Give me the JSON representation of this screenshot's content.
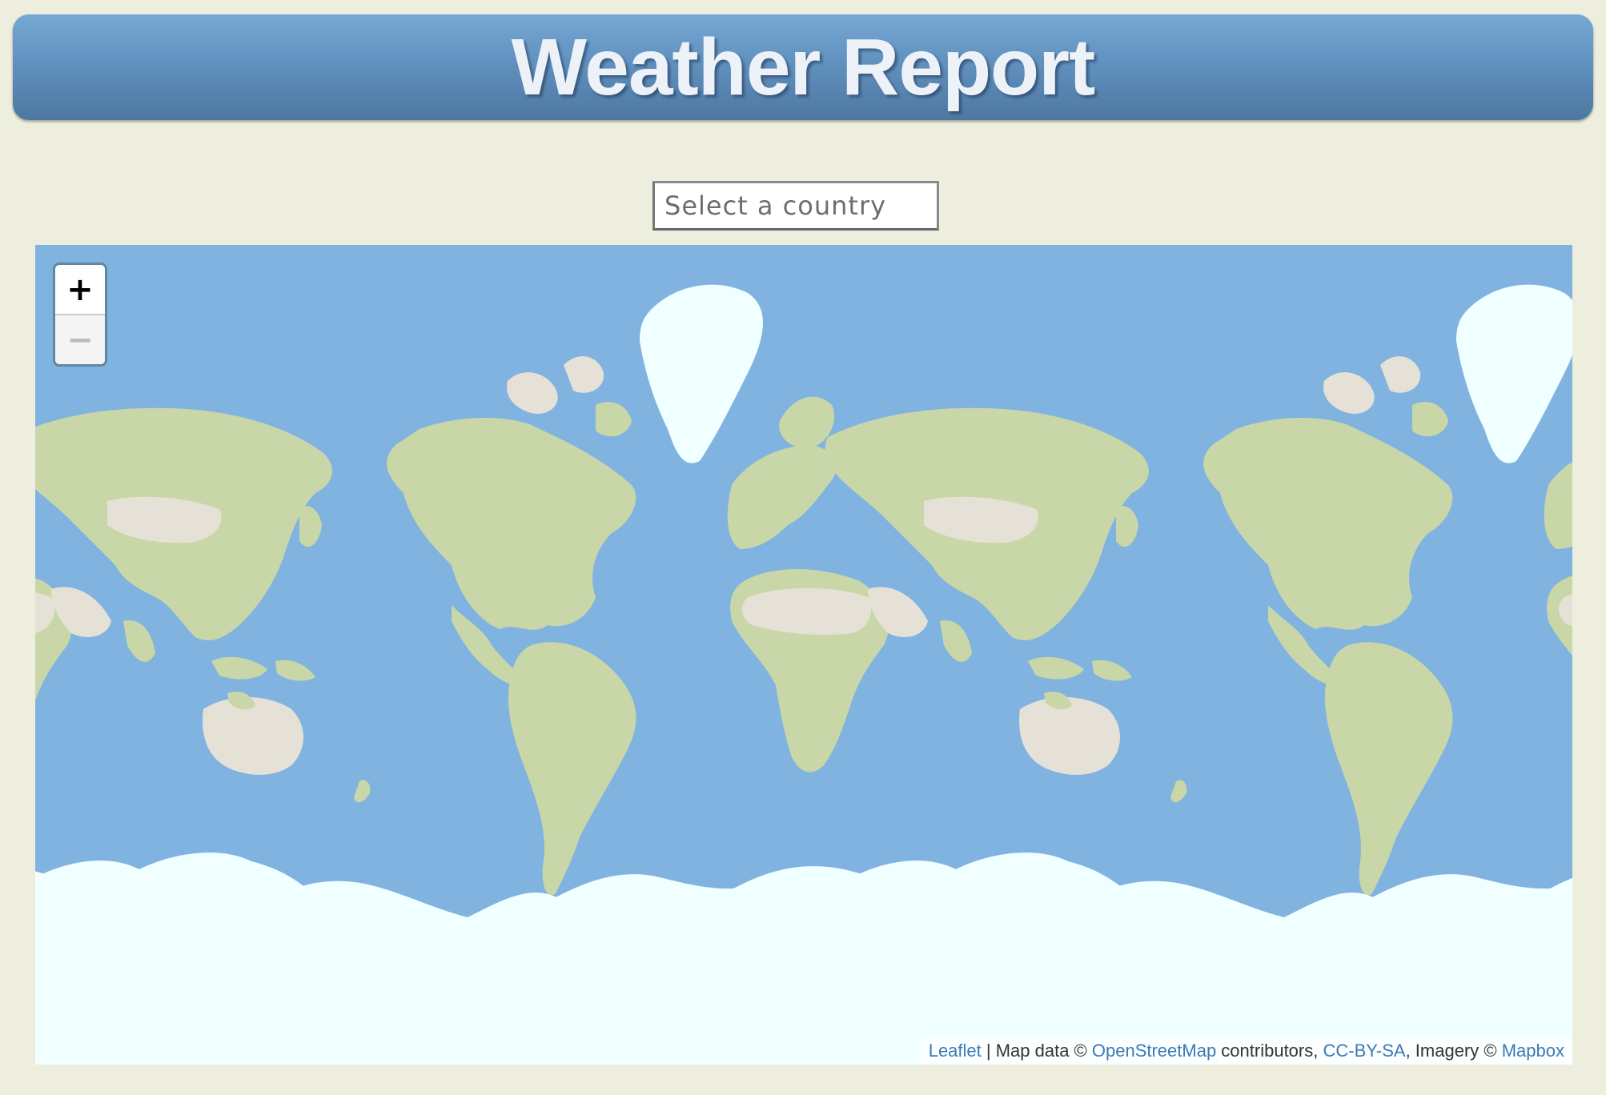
{
  "header": {
    "title": "Weather Report"
  },
  "search": {
    "placeholder": "Select a country",
    "value": ""
  },
  "map": {
    "zoom_in_label": "+",
    "zoom_out_label": "−",
    "zoom_out_disabled": true,
    "colors": {
      "ocean": "#80b3e0",
      "land": "#c9d7a8",
      "desert": "#e6e1d6",
      "ice": "#f0ffff"
    },
    "attribution": {
      "leaflet": "Leaflet",
      "sep1": " | Map data © ",
      "osm": "OpenStreetMap",
      "sep2": " contributors, ",
      "license": "CC-BY-SA",
      "sep3": ", Imagery © ",
      "mapbox": "Mapbox"
    }
  }
}
